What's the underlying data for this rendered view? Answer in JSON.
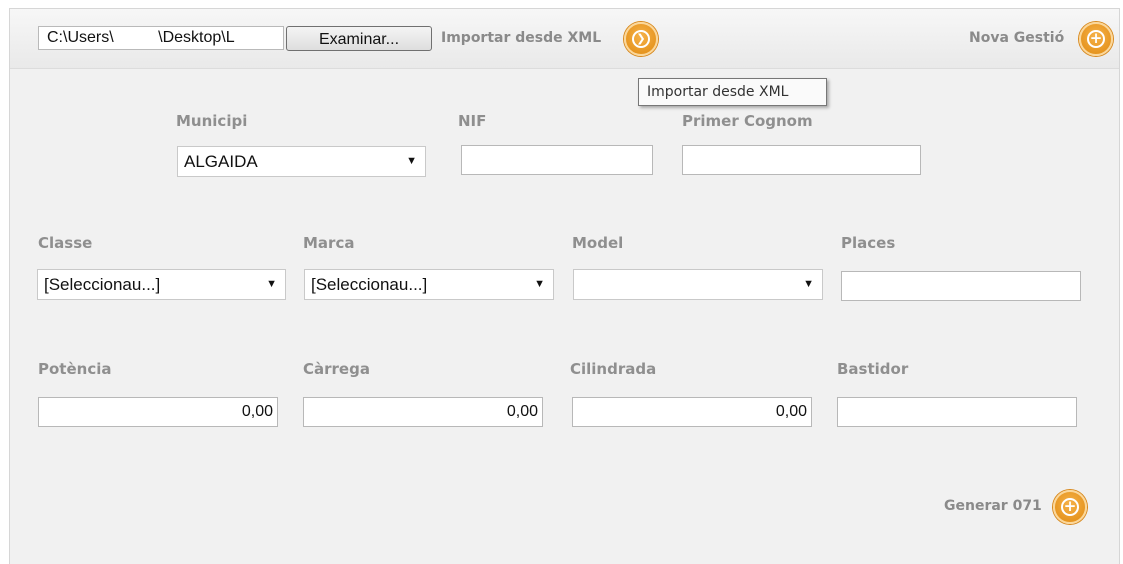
{
  "toolbar": {
    "file_path": "C:\\Users\\          \\Desktop\\L",
    "browse_label": "Examinar...",
    "import_label": "Importar desde XML",
    "import_tooltip": "Importar desde XML",
    "new_label": "Nova Gestió"
  },
  "row1": {
    "municipi_label": "Municipi",
    "municipi_value": "ALGAIDA",
    "nif_label": "NIF",
    "nif_value": "",
    "cognom_label": "Primer Cognom",
    "cognom_value": ""
  },
  "row2": {
    "classe_label": "Classe",
    "classe_value": "[Seleccionau...]",
    "marca_label": "Marca",
    "marca_value": "[Seleccionau...]",
    "model_label": "Model",
    "model_value": "",
    "places_label": "Places",
    "places_value": ""
  },
  "row3": {
    "potencia_label": "Potència",
    "potencia_value": "0,00",
    "carrega_label": "Càrrega",
    "carrega_value": "0,00",
    "cilindrada_label": "Cilindrada",
    "cilindrada_value": "0,00",
    "bastidor_label": "Bastidor",
    "bastidor_value": ""
  },
  "footer": {
    "generate_label": "Generar 071"
  },
  "icons": {
    "import": "arrow-right-circle-icon",
    "add": "plus-circle-icon",
    "dropdown": "chevron-down-icon"
  },
  "colors": {
    "accent": "#e8961e",
    "label": "#8f8f8f",
    "panel_bg": "#f1f1f1"
  }
}
